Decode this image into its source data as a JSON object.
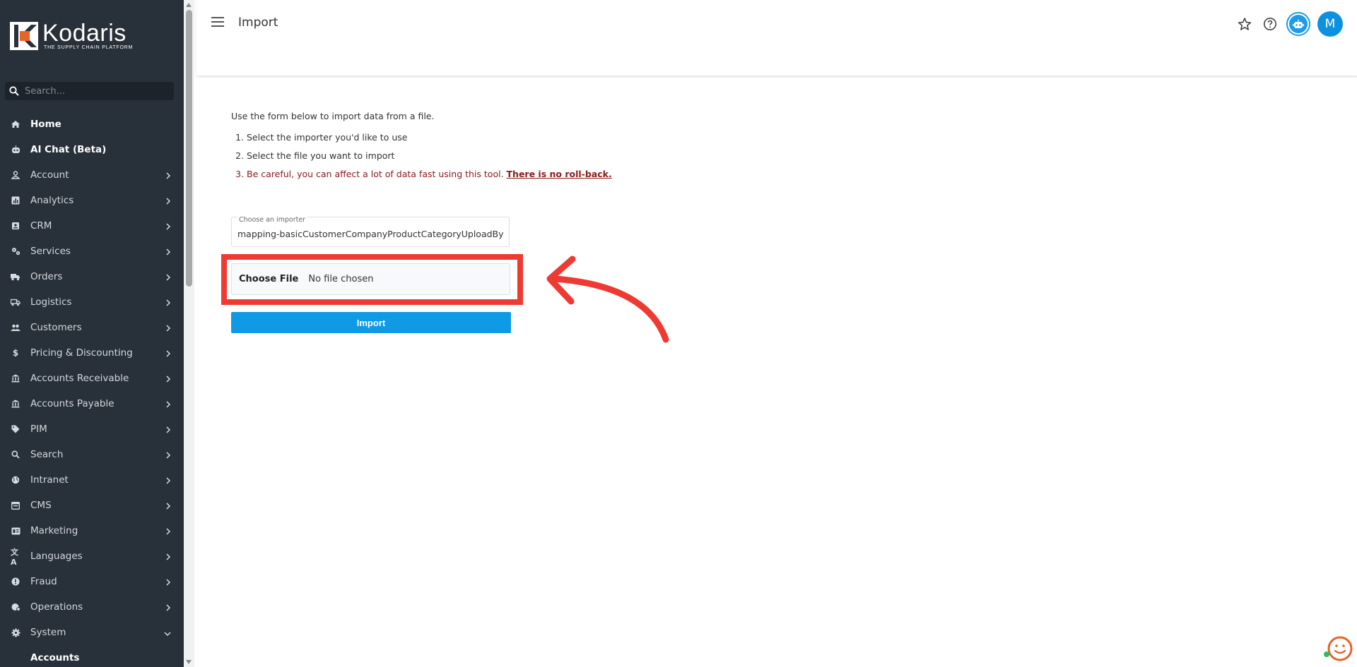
{
  "brand": {
    "name": "Kodaris",
    "tagline": "THE SUPPLY CHAIN PLATFORM",
    "accent": "#e8622c"
  },
  "search": {
    "placeholder": "Search..."
  },
  "sidebar": {
    "items": [
      {
        "label": "Home",
        "icon": "home-icon",
        "chevron": false,
        "bold": true
      },
      {
        "label": "AI Chat (Beta)",
        "icon": "robot-icon",
        "chevron": false,
        "bold": true
      },
      {
        "label": "Account",
        "icon": "person-icon",
        "chevron": true
      },
      {
        "label": "Analytics",
        "icon": "chart-icon",
        "chevron": true
      },
      {
        "label": "CRM",
        "icon": "contact-card-icon",
        "chevron": true
      },
      {
        "label": "Services",
        "icon": "gears-icon",
        "chevron": true
      },
      {
        "label": "Orders",
        "icon": "truck-icon",
        "chevron": true
      },
      {
        "label": "Logistics",
        "icon": "delivery-icon",
        "chevron": true
      },
      {
        "label": "Customers",
        "icon": "people-icon",
        "chevron": true
      },
      {
        "label": "Pricing & Discounting",
        "icon": "dollar-icon",
        "chevron": true
      },
      {
        "label": "Accounts Receivable",
        "icon": "bank-icon",
        "chevron": true
      },
      {
        "label": "Accounts Payable",
        "icon": "bank-icon",
        "chevron": true
      },
      {
        "label": "PIM",
        "icon": "tag-icon",
        "chevron": true
      },
      {
        "label": "Search",
        "icon": "search-icon",
        "chevron": true
      },
      {
        "label": "Intranet",
        "icon": "globe-icon",
        "chevron": true
      },
      {
        "label": "CMS",
        "icon": "browser-icon",
        "chevron": true
      },
      {
        "label": "Marketing",
        "icon": "ad-icon",
        "chevron": true
      },
      {
        "label": "Languages",
        "icon": "translate-icon",
        "chevron": true
      },
      {
        "label": "Fraud",
        "icon": "alert-icon",
        "chevron": true
      },
      {
        "label": "Operations",
        "icon": "ops-icon",
        "chevron": true
      },
      {
        "label": "System",
        "icon": "gear-icon",
        "chevron": true,
        "expanded": true
      }
    ],
    "subitems": [
      {
        "label": "Accounts"
      }
    ]
  },
  "header": {
    "title": "Import",
    "avatar_initial": "M"
  },
  "content": {
    "intro": "Use the form below to import data from a file.",
    "step1": "Select the importer you'd like to use",
    "step2": "Select the file you want to import",
    "step3_text": "Be careful, you can affect a lot of data fast using this tool. ",
    "step3_bold": "There is no roll-back."
  },
  "form": {
    "importer_label": "Choose an importer",
    "importer_value": "mapping-basicCustomerCompanyProductCategoryUploadByExternalId",
    "file_button": "Choose File",
    "file_status": "No file chosen",
    "submit_label": "Import"
  },
  "colors": {
    "sidebar_bg": "#283039",
    "primary": "#0f9ae6",
    "highlight": "#ef3a33",
    "warning_text": "#8b1a1a"
  }
}
